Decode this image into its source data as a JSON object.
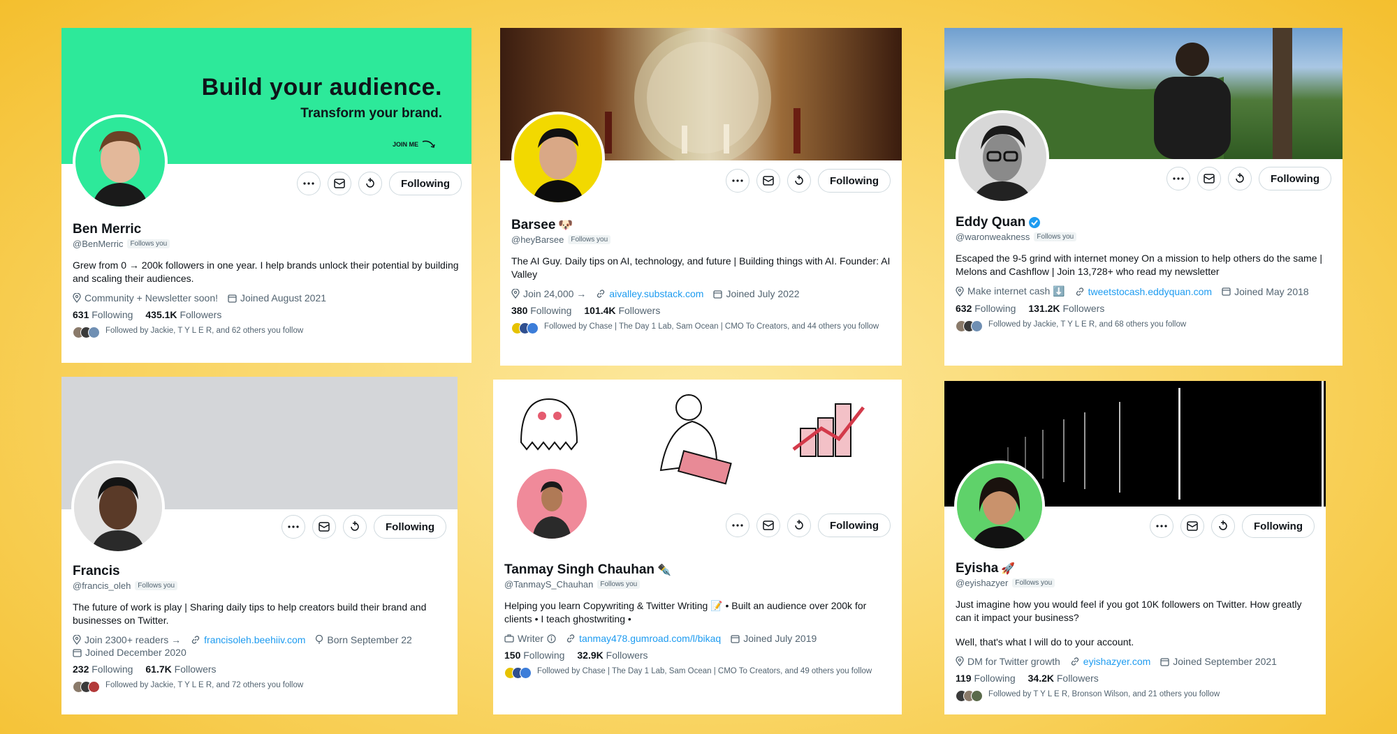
{
  "colors": {
    "background": "#f9d462",
    "link": "#1d9bf0",
    "verified": "#1d9bf0",
    "banner_green": "#2de99a"
  },
  "action_icons": [
    "more-icon",
    "message-icon",
    "subscribe-icon"
  ],
  "cards": [
    {
      "banner_title": "Build your audience.",
      "banner_subtitle": "Transform your brand.",
      "banner_cta": "JOIN ME",
      "following_button": "Following",
      "name": "Ben Merric",
      "handle": "@BenMerric",
      "follows_you": "Follows you",
      "bio": "Grew from 0 → 200k followers in one year. I help brands unlock their potential by building and scaling their audiences.",
      "location": "Community + Newsletter soon!",
      "joined": "Joined August 2021",
      "following_count": "631",
      "following_label": "Following",
      "followers_count": "435.1K",
      "followers_label": "Followers",
      "followed_by": "Followed by Jackie, T Y L E R, and 62 others you follow"
    },
    {
      "following_button": "Following",
      "name": "Barsee",
      "handle": "@heyBarsee",
      "follows_you": "Follows you",
      "bio": "The AI Guy. Daily tips on AI, technology, and future | Building things with AI. Founder: AI Valley",
      "location": "Join 24,000 →",
      "website": "aivalley.substack.com",
      "joined": "Joined July 2022",
      "following_count": "380",
      "following_label": "Following",
      "followers_count": "101.4K",
      "followers_label": "Followers",
      "followed_by": "Followed by Chase | The Day 1 Lab, Sam Ocean | CMO To Creators, and 44 others you follow"
    },
    {
      "following_button": "Following",
      "name": "Eddy Quan",
      "handle": "@waronweakness",
      "follows_you": "Follows you",
      "bio": "Escaped the 9-5 grind with internet money On a mission to help others do the same | Melons and Cashflow | Join 13,728+ who read my newsletter",
      "location": "Make internet cash ⬇️",
      "website": "tweetstocash.eddyquan.com",
      "joined": "Joined May 2018",
      "following_count": "632",
      "following_label": "Following",
      "followers_count": "131.2K",
      "followers_label": "Followers",
      "followed_by": "Followed by Jackie, T Y L E R, and 68 others you follow"
    },
    {
      "following_button": "Following",
      "name": "Francis",
      "handle": "@francis_oleh",
      "follows_you": "Follows you",
      "bio": "The future of work is play | Sharing daily tips to help creators build their brand and businesses on Twitter.",
      "location": "Join 2300+ readers →",
      "website": "francisoleh.beehiiv.com",
      "born": "Born September 22",
      "joined": "Joined December 2020",
      "following_count": "232",
      "following_label": "Following",
      "followers_count": "61.7K",
      "followers_label": "Followers",
      "followed_by": "Followed by Jackie, T Y L E R, and 72 others you follow"
    },
    {
      "following_button": "Following",
      "name": "Tanmay Singh Chauhan",
      "handle": "@TanmayS_Chauhan",
      "follows_you": "Follows you",
      "bio": "Helping you learn Copywriting & Twitter Writing 📝 • Built an audience over 200k for clients • I teach ghostwriting •",
      "category": "Writer",
      "website": "tanmay478.gumroad.com/l/bikaq",
      "joined": "Joined July 2019",
      "following_count": "150",
      "following_label": "Following",
      "followers_count": "32.9K",
      "followers_label": "Followers",
      "followed_by": "Followed by Chase | The Day 1 Lab, Sam Ocean | CMO To Creators, and 49 others you follow"
    },
    {
      "following_button": "Following",
      "name": "Eyisha",
      "handle": "@eyishazyer",
      "follows_you": "Follows you",
      "bio": "Just imagine how you would feel if you got 10K followers on Twitter. How greatly can it impact your business?",
      "bio2": "Well, that's what I will do to your account.",
      "location": "DM for Twitter growth",
      "website": "eyishazyer.com",
      "joined": "Joined September 2021",
      "following_count": "119",
      "following_label": "Following",
      "followers_count": "34.2K",
      "followers_label": "Followers",
      "followed_by": "Followed by T Y L E R, Bronson Wilson, and 21 others you follow"
    }
  ]
}
